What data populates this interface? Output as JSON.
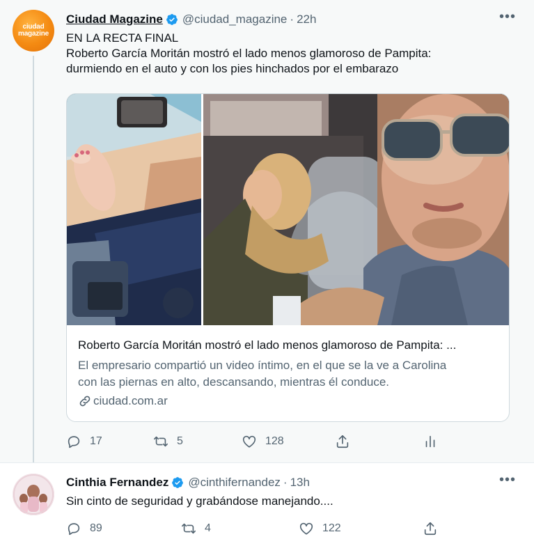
{
  "tweets": [
    {
      "name": "Ciudad Magazine",
      "handle": "@ciudad_magazine",
      "separator": "·",
      "time": "22h",
      "avatar_text": [
        "ciudad",
        "magazine"
      ],
      "text_line1": "EN LA RECTA FINAL",
      "text_line2": "Roberto García Moritán mostró el lado menos glamoroso de Pampita:",
      "text_line3": "durmiendo en el auto y con los pies hinchados por el embarazo",
      "card": {
        "title": "Roberto García Moritán mostró el lado menos glamoroso de Pampita: ...",
        "desc_line1": "El empresario compartió un video íntimo, en el que se la ve a Carolina",
        "desc_line2": "con las piernas en alto, descansando, mientras él conduce.",
        "domain": "ciudad.com.ar"
      },
      "actions": {
        "replies": "17",
        "retweets": "5",
        "likes": "128"
      }
    },
    {
      "name": "Cinthia Fernandez",
      "handle": "@cinthifernandez",
      "separator": "·",
      "time": "13h",
      "text": "Sin cinto de seguridad y grabándose manejando....",
      "actions": {
        "replies": "89",
        "retweets": "4",
        "likes": "122"
      }
    }
  ],
  "colors": {
    "verified": "#1d9bf0",
    "muted": "#536471",
    "text": "#0f1419",
    "brand_orange": "#f48a12"
  },
  "icons": [
    "verified-badge-icon",
    "more-icon",
    "reply-icon",
    "retweet-icon",
    "like-icon",
    "share-icon",
    "analytics-icon",
    "link-icon"
  ]
}
